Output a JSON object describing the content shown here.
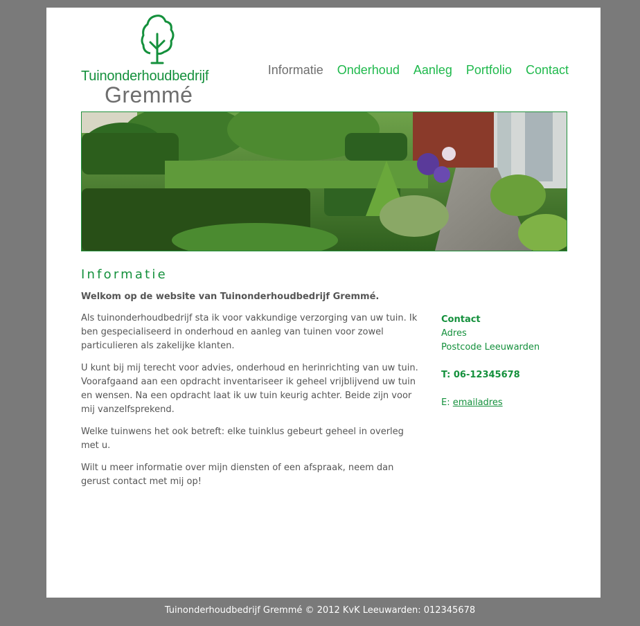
{
  "brand": {
    "line1": "Tuinonderhoudbedrijf",
    "line2": "Gremmé",
    "logo_icon": "tree-icon",
    "green": "#14903c",
    "grey": "#6e6e6e"
  },
  "nav": {
    "items": [
      {
        "label": "Informatie",
        "active": true
      },
      {
        "label": "Onderhoud"
      },
      {
        "label": "Aanleg"
      },
      {
        "label": "Portfolio"
      },
      {
        "label": "Contact"
      }
    ]
  },
  "hero": {
    "image": "garden-photo"
  },
  "main": {
    "title": "Informatie",
    "welcome": "Welkom op de website van Tuinonderhoudbedrijf Gremmé.",
    "paragraphs": [
      "Als tuinonderhoudbedrijf sta ik voor vakkundige verzorging van uw tuin. Ik ben gespecialiseerd in onderhoud en aanleg van tuinen voor zowel particulieren als zakelijke klanten.",
      "U kunt bij mij terecht voor advies, onderhoud en herinrichting van uw tuin. Voorafgaand aan een opdracht inventariseer ik geheel vrijblijvend uw tuin en wensen. Na een opdracht laat ik uw tuin keurig achter. Beide zijn voor mij vanzelfsprekend.",
      "Welke tuinwens het ook betreft: elke tuinklus gebeurt geheel in overleg met u.",
      "Wilt u meer informatie over mijn diensten of een afspraak, neem dan gerust contact met mij op!"
    ]
  },
  "contact": {
    "heading": "Contact",
    "address": "Adres",
    "postcode": "Postcode Leeuwarden",
    "phone": "T: 06-12345678",
    "email_prefix": "E: ",
    "email_link": "emailadres"
  },
  "footer": {
    "text": "Tuinonderhoudbedrijf Gremmé © 2012 KvK Leeuwarden: 012345678"
  }
}
